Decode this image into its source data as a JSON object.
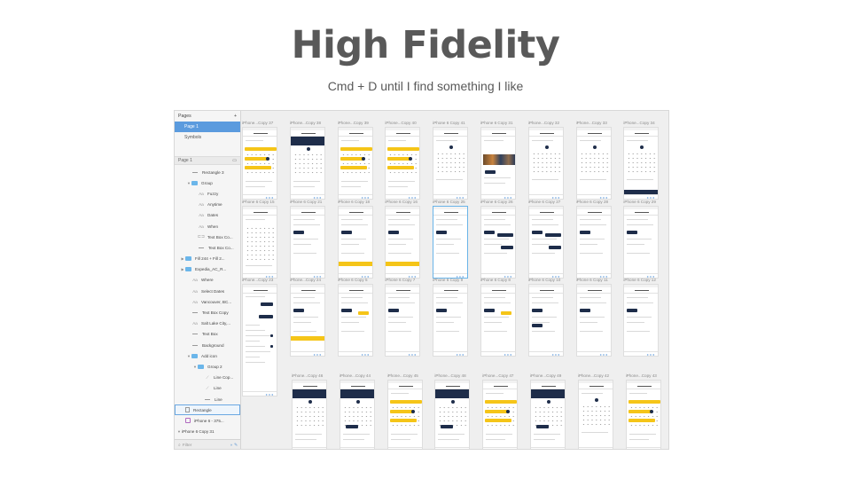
{
  "slide": {
    "title": "High Fidelity",
    "subtitle": "Cmd + D until I find something I like"
  },
  "sidebar": {
    "pages_header": "Pages",
    "add_icon": "+",
    "pages": [
      {
        "label": "Page 1",
        "selected": true
      },
      {
        "label": "Symbols",
        "selected": false
      }
    ],
    "layers_page_label": "Page 1",
    "layers": [
      {
        "label": "Rectangle 3",
        "icon": "line-icon",
        "indent": 1,
        "caret": ""
      },
      {
        "label": "Group",
        "icon": "folder-icon",
        "indent": 1,
        "caret": "▼"
      },
      {
        "label": "Fuzzy",
        "icon": "text-icon",
        "indent": 2,
        "caret": ""
      },
      {
        "label": "Anytime",
        "icon": "text-icon",
        "indent": 2,
        "caret": ""
      },
      {
        "label": "Dates",
        "icon": "text-icon",
        "indent": 2,
        "caret": ""
      },
      {
        "label": "When",
        "icon": "text-icon",
        "indent": 2,
        "caret": ""
      },
      {
        "label": "Text Box Co...",
        "icon": "symbol-icon",
        "indent": 2,
        "caret": ""
      },
      {
        "label": "Text Box Co...",
        "icon": "line-icon",
        "indent": 2,
        "caret": ""
      },
      {
        "label": "Fill 244 + Fill 2...",
        "icon": "folder-icon",
        "indent": 0,
        "caret": "▶"
      },
      {
        "label": "Expedia_AC_R...",
        "icon": "folder-icon",
        "indent": 0,
        "caret": "▶"
      },
      {
        "label": "Where",
        "icon": "text-icon",
        "indent": 1,
        "caret": ""
      },
      {
        "label": "Select Dates",
        "icon": "text-icon",
        "indent": 1,
        "caret": ""
      },
      {
        "label": "Vancouver, BC...",
        "icon": "text-icon",
        "indent": 1,
        "caret": ""
      },
      {
        "label": "Text Box Copy",
        "icon": "line-icon",
        "indent": 1,
        "caret": ""
      },
      {
        "label": "Salt Lake City,...",
        "icon": "text-icon",
        "indent": 1,
        "caret": ""
      },
      {
        "label": "Text Box",
        "icon": "line-icon",
        "indent": 1,
        "caret": ""
      },
      {
        "label": "Background",
        "icon": "line-icon",
        "indent": 1,
        "caret": ""
      },
      {
        "label": "Add icon",
        "icon": "folder-icon",
        "indent": 1,
        "caret": "▼"
      },
      {
        "label": "Group 2",
        "icon": "folder-icon",
        "indent": 2,
        "caret": "▼"
      },
      {
        "label": "Line Cop...",
        "icon": "diag-line-icon",
        "indent": 3,
        "caret": ""
      },
      {
        "label": "Line",
        "icon": "diag-line-icon",
        "indent": 3,
        "caret": ""
      },
      {
        "label": "Line",
        "icon": "line-icon",
        "indent": 3,
        "caret": ""
      },
      {
        "label": "Rectangle",
        "icon": "rect-icon",
        "indent": 0,
        "caret": "",
        "selected": true
      },
      {
        "label": "iPhone 6 - 375...",
        "icon": "artboard-icon",
        "indent": 0,
        "caret": ""
      },
      {
        "label": "iPhone 6 Copy 31",
        "icon": "",
        "indent": -1,
        "caret": "▼"
      }
    ],
    "filter_placeholder": "Filter"
  },
  "artboards": {
    "rows": [
      {
        "labels": [
          "iPhone...Copy 37",
          "iPhone...Copy 38",
          "iPhone...Copy 39",
          "iPhone...Copy 40",
          "iPhone 6 Copy 41",
          "iPhone 6 Copy 31",
          "iPhone...Copy 32",
          "iPhone...Copy 33",
          "iPhone...Copy 34"
        ]
      },
      {
        "labels": [
          "iPhone 6 Copy 15",
          "iPhone 6 Copy 21",
          "iPhone 6 Copy 18",
          "iPhone 6 Copy 16",
          "iPhone 6 Copy 25",
          "iPhone 6 Copy 26",
          "iPhone 6 Copy 27",
          "iPhone 6 Copy 28",
          "iPhone 6 Copy 29"
        ]
      },
      {
        "labels": [
          "iPhone...Copy 23",
          "iPhone...Copy 24",
          "iPhone 6 Copy 5",
          "iPhone 6 Copy 7",
          "iPhone 6 Copy 9",
          "iPhone 6 Copy 8",
          "iPhone 6 Copy 10",
          "iPhone 6 Copy 11",
          "iPhone 6 Copy 12"
        ]
      },
      {
        "labels": [
          "iPhone...Copy 46",
          "iPhone...Copy 44",
          "iPhone...Copy 45",
          "iPhone...Copy 48",
          "iPhone...Copy 47",
          "iPhone...Copy 49",
          "iPhone...Copy 42",
          "iPhone...Copy 43"
        ]
      }
    ]
  },
  "colors": {
    "accent_yellow": "#f5c518",
    "navy": "#1e2d4a",
    "selection_blue": "#5b9bde"
  }
}
